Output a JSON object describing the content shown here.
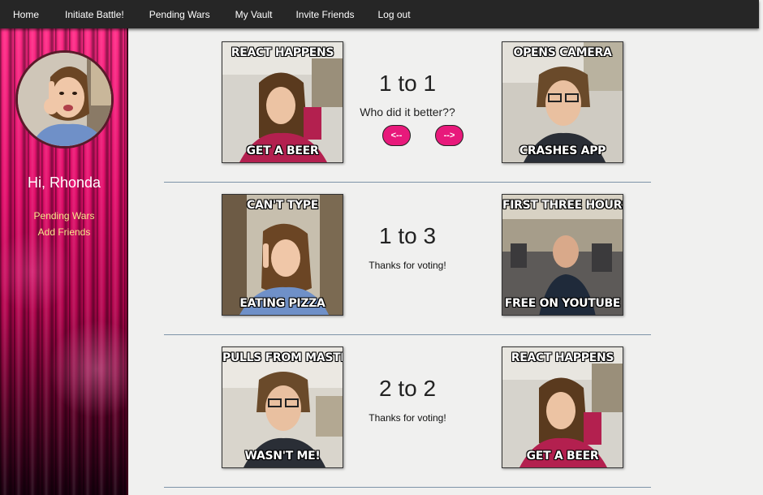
{
  "nav": {
    "items": [
      "Home",
      "Initiate Battle!",
      "Pending Wars",
      "My Vault",
      "Invite Friends",
      "Log out"
    ]
  },
  "sidebar": {
    "greeting": "Hi, Rhonda",
    "links": [
      "Pending Wars",
      "Add Friends"
    ]
  },
  "wars": [
    {
      "left": {
        "top": "REACT HAPPENS",
        "bottom": "GET A BEER"
      },
      "right": {
        "top": "OPENS CAMERA",
        "bottom": "CRASHES APP"
      },
      "score": "1 to 1",
      "prompt": "Who did it better??",
      "prev_label": "<--",
      "next_label": "-->"
    },
    {
      "left": {
        "top": "CAN'T TYPE",
        "bottom": "EATING PIZZA"
      },
      "right": {
        "top": "FIRST THREE HOURS",
        "bottom": "FREE ON YOUTUBE"
      },
      "score": "1 to 3",
      "status": "Thanks for voting!"
    },
    {
      "left": {
        "top": "PULLS FROM MASTER",
        "bottom": "WASN'T ME!"
      },
      "right": {
        "top": "REACT HAPPENS",
        "bottom": "GET A BEER"
      },
      "score": "2 to 2",
      "status": "Thanks for voting!"
    }
  ],
  "colors": {
    "navbar": "#262626",
    "accent": "#e8197b",
    "link": "#f5e88a",
    "divider": "#7d93a8"
  }
}
